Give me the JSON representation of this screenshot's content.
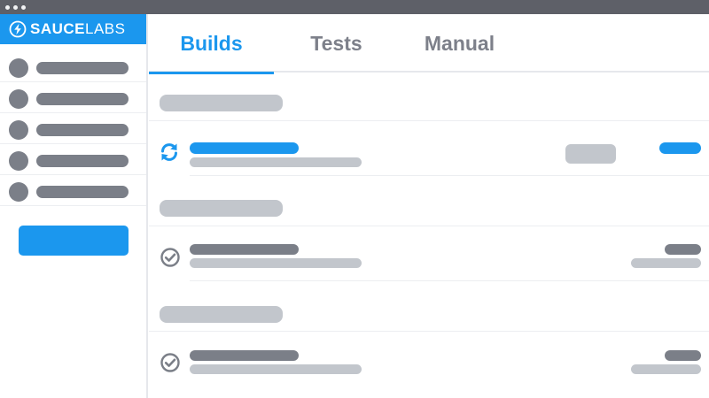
{
  "brand": {
    "name_bold": "SAUCE",
    "name_light": "LABS",
    "color": "#1b97ee"
  },
  "window": {
    "controls": [
      "dot",
      "dot",
      "dot"
    ]
  },
  "tabs": [
    {
      "label": "Builds",
      "active": true
    },
    {
      "label": "Tests",
      "active": false
    },
    {
      "label": "Manual",
      "active": false
    }
  ],
  "builds": [
    {
      "status_icon": "refresh-icon",
      "status": "running"
    },
    {
      "status_icon": "check-circle-icon",
      "status": "passed"
    },
    {
      "status_icon": "check-circle-icon",
      "status": "passed"
    }
  ],
  "colors": {
    "accent": "#1b97ee",
    "titlebar": "#5e6068",
    "placeholder_dark": "#7b7f88",
    "placeholder_light": "#c2c6cc"
  }
}
